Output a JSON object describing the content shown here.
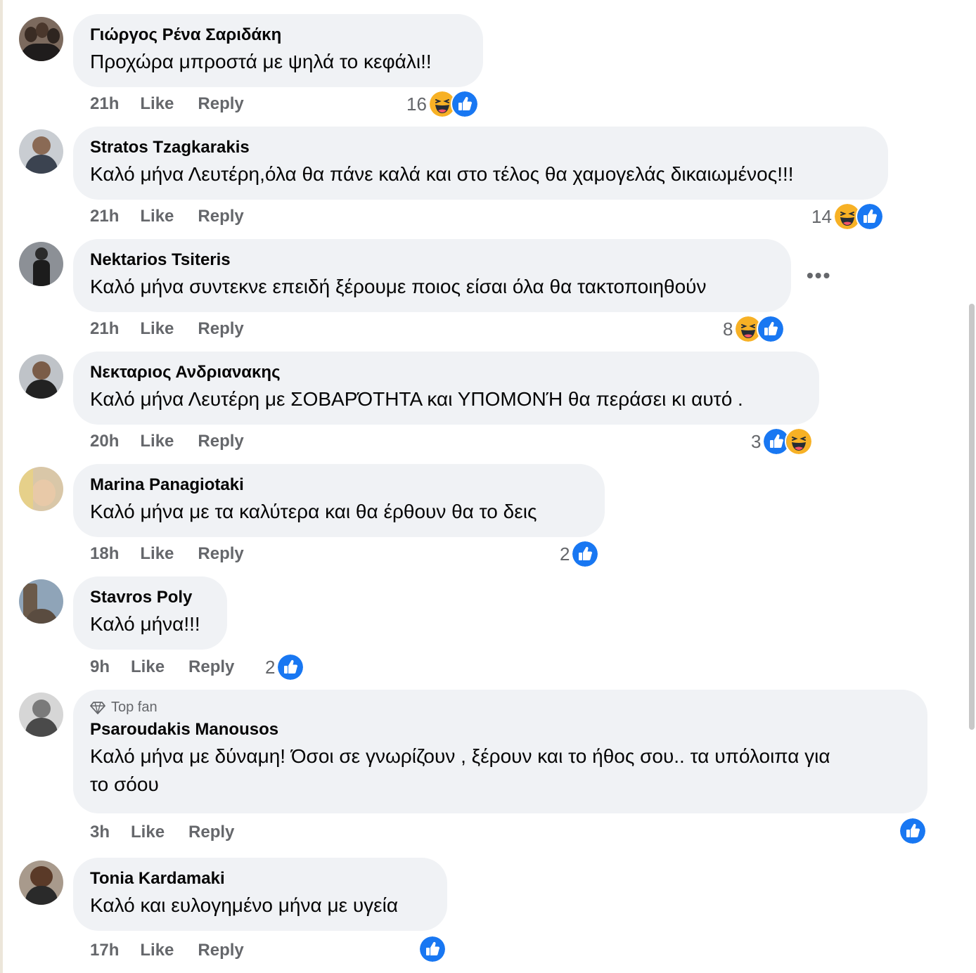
{
  "labels": {
    "like": "Like",
    "reply": "Reply",
    "top_fan": "Top fan",
    "more": "•••"
  },
  "colors": {
    "bubble": "#f0f2f5",
    "meta": "#65676b",
    "like_blue": "#1877f2",
    "haha_yellow": "#f7b125"
  },
  "comments": [
    {
      "author": "Γιώργος Ρένα Σαριδάκη",
      "text": "Προχώρα μπροστά με ψηλά το κεφάλι!!",
      "time": "21h",
      "count": "16",
      "reactions": [
        "haha-icon",
        "like-icon"
      ]
    },
    {
      "author": "Stratos Tzagkarakis",
      "text": "Καλό μήνα Λευτέρη,όλα θα πάνε καλά και στο τέλος θα χαμογελάς δικαιωμένος!!!",
      "time": "21h",
      "count": "14",
      "reactions": [
        "haha-icon",
        "like-icon"
      ]
    },
    {
      "author": "Nektarios Tsiteris",
      "text": "Καλό μήνα συντεκνε επειδή ξέρουμε ποιος είσαι όλα θα τακτοποιηθούν",
      "time": "21h",
      "count": "8",
      "reactions": [
        "haha-icon",
        "like-icon"
      ]
    },
    {
      "author": "Νεκταριος Ανδριανακης",
      "text": "Καλό μήνα Λευτέρη με ΣΟΒΑΡΌΤΗΤΑ και ΥΠΟΜΟΝΉ θα περάσει κι αυτό .",
      "time": "20h",
      "count": "3",
      "reactions": [
        "like-icon",
        "haha-icon"
      ]
    },
    {
      "author": "Marina Panagiotaki",
      "text": "Καλό μήνα με τα καλύτερα και θα έρθουν θα το δεις",
      "time": "18h",
      "count": "2",
      "reactions": [
        "like-icon"
      ]
    },
    {
      "author": "Stavros Poly",
      "text": "Καλό μήνα!!!",
      "time": "9h",
      "count": "2",
      "reactions": [
        "like-icon"
      ]
    },
    {
      "author": "Psaroudakis Manousos",
      "badge": "Top fan",
      "text_line1": "Καλό μήνα με δύναμη! Όσοι σε γνωρίζουν , ξέρουν και το ήθος σου.. τα υπόλοιπα για",
      "text_line2": "το σόου",
      "time": "3h",
      "count": "",
      "reactions": [
        "like-icon"
      ]
    },
    {
      "author": "Tonia Kardamaki",
      "text": "Καλό και ευλογημένο μήνα με υγεία",
      "time": "17h",
      "count": "",
      "reactions": [
        "like-icon"
      ]
    }
  ]
}
